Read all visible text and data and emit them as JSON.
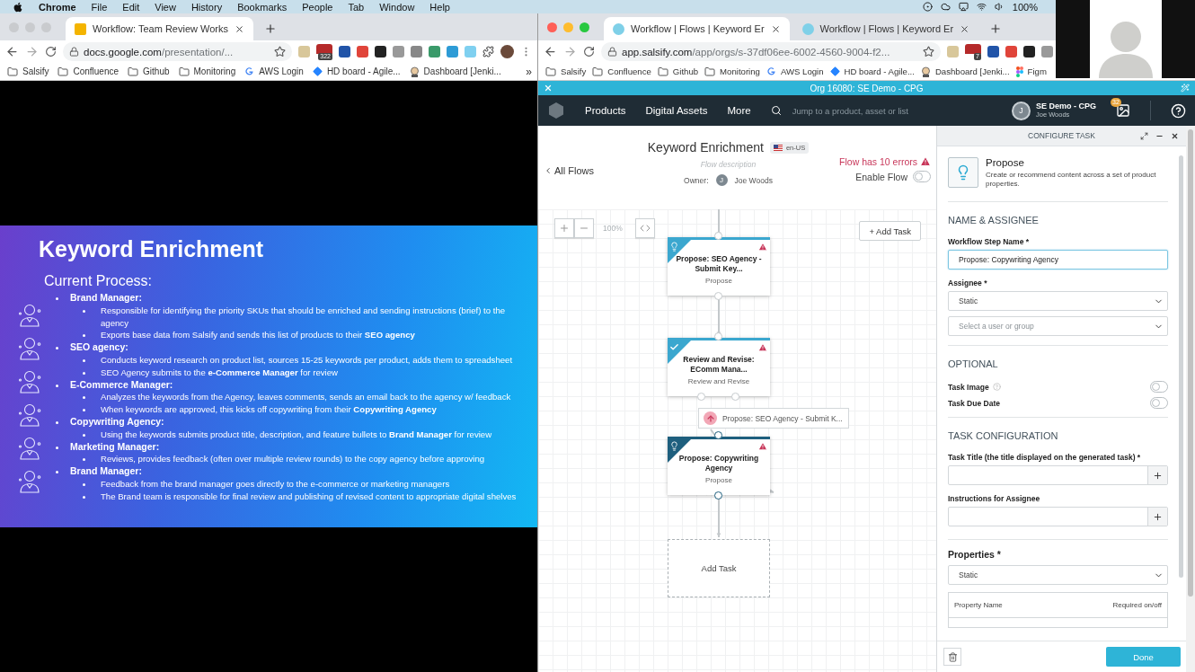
{
  "menu_bar": {
    "app_name": "Chrome",
    "items": [
      "File",
      "Edit",
      "View",
      "History",
      "Bookmarks",
      "People",
      "Tab",
      "Window",
      "Help"
    ],
    "battery": "100%"
  },
  "left_window": {
    "active": false,
    "tabs": [
      {
        "title": "Workflow: Team Review Works",
        "selected": true
      }
    ],
    "url": {
      "host": "docs.google.com",
      "path": "/presentation/..."
    },
    "extension_badge": "322",
    "bookmarks": [
      {
        "label": "Salsify",
        "kind": "folder"
      },
      {
        "label": "Confluence",
        "kind": "folder"
      },
      {
        "label": "Github",
        "kind": "folder"
      },
      {
        "label": "Monitoring",
        "kind": "folder"
      },
      {
        "label": "AWS Login",
        "kind": "g"
      },
      {
        "label": "HD board - Agile...",
        "kind": "diamond"
      },
      {
        "label": "Dashboard [Jenki...",
        "kind": "face"
      }
    ],
    "bookmarks_overflow": "»",
    "slide": {
      "title": "Keyword Enrichment",
      "subtitle": "Current Process:",
      "items": [
        {
          "text": "Brand Manager:",
          "children": [
            "Responsible for identifying the priority SKUs that should be enriched and sending instructions (brief) to the agency",
            "Exports base data from Salsify and sends this list of products to their **SEO agency**"
          ]
        },
        {
          "text": "SEO agency:",
          "children": [
            "Conducts keyword research on product list, sources 15-25 keywords per product, adds them to spreadsheet",
            "SEO Agency submits to the **e-Commerce Manager** for review"
          ]
        },
        {
          "text": "E-Commerce Manager:",
          "children": [
            "Analyzes the keywords from the Agency, leaves comments, sends an email back to the agency w/ feedback",
            "When keywords are approved, this kicks off copywriting from their **Copywriting Agency**"
          ]
        },
        {
          "text": "Copywriting Agency:",
          "children": [
            "Using the keywords submits product title, description, and feature bullets to **Brand Manager** for review"
          ]
        },
        {
          "text": "Marketing Manager:",
          "children": [
            "Reviews, provides feedback (often over multiple review rounds) to the copy agency before approving"
          ]
        },
        {
          "text": "Brand Manager:",
          "children": [
            "Feedback from the brand manager goes directly to the e-commerce or marketing managers",
            "The Brand team is responsible for final review and publishing of revised content to appropriate digital shelves"
          ]
        }
      ]
    }
  },
  "right_window": {
    "active": true,
    "tabs": [
      {
        "title": "Workflow | Flows | Keyword Er",
        "selected": true
      },
      {
        "title": "Workflow | Flows | Keyword Er",
        "selected": false
      }
    ],
    "url": {
      "host": "app.salsify.com",
      "path": "/app/orgs/s-37df06ee-6002-4560-9004-f2..."
    },
    "extension_badge": "7",
    "bookmarks": [
      {
        "label": "Salsify",
        "kind": "folder"
      },
      {
        "label": "Confluence",
        "kind": "folder"
      },
      {
        "label": "Github",
        "kind": "folder"
      },
      {
        "label": "Monitoring",
        "kind": "folder"
      },
      {
        "label": "AWS Login",
        "kind": "g"
      },
      {
        "label": "HD board - Agile...",
        "kind": "diamond"
      },
      {
        "label": "Dashboard [Jenki...",
        "kind": "face"
      },
      {
        "label": "Figm",
        "kind": "shapes"
      }
    ],
    "app": {
      "org_bar": {
        "title": "Org 16080: SE Demo - CPG"
      },
      "nav": {
        "items": [
          {
            "label": "Products"
          },
          {
            "label": "Digital Assets"
          },
          {
            "label": "More"
          }
        ],
        "search": {
          "placeholder": "Jump to a product, asset or list"
        },
        "account": {
          "initial": "J",
          "org": "SE Demo - CPG",
          "user": "Joe Woods"
        },
        "notification_count": "32"
      },
      "flow": {
        "back_link": "All Flows",
        "title": "Keyword Enrichment",
        "locale": "en-US",
        "description": {
          "placeholder": "Flow description"
        },
        "owner_label": "Owner:",
        "owner": {
          "initial": "J",
          "name": "Joe Woods"
        },
        "errors": "Flow has 10 errors",
        "enable": {
          "label": "Enable Flow",
          "on": false
        },
        "zoom": "100%",
        "add_task": "+ Add Task",
        "nodes": [
          {
            "kind": "propose",
            "title": "Propose: SEO Agency - Submit Key...",
            "subtitle": "Propose",
            "error": true,
            "selected": false
          },
          {
            "kind": "review",
            "title": "Review and Revise: EComm Mana...",
            "subtitle": "Review and Revise",
            "error": true,
            "selected": false
          },
          {
            "kind": "propose",
            "title": "Propose: Copywriting Agency",
            "subtitle": "Propose",
            "error": true,
            "selected": true
          }
        ],
        "link_label": "Propose: SEO Agency - Submit K...",
        "placeholder_node": "Add Task"
      },
      "panel": {
        "title": "CONFIGURE TASK",
        "task_type": {
          "name": "Propose",
          "description": "Create or recommend content across a set of product properties."
        },
        "name_section": "NAME & ASSIGNEE",
        "step_name": {
          "label": "Workflow Step Name *",
          "value": "Propose: Copywriting Agency"
        },
        "assignee": {
          "label": "Assignee *",
          "mode": "Static",
          "user": {
            "placeholder": "Select a user or group"
          }
        },
        "optional_section": "OPTIONAL",
        "toggles": [
          {
            "label": "Task Image",
            "help": true,
            "on": false
          },
          {
            "label": "Task Due Date",
            "help": false,
            "on": false
          }
        ],
        "config_section": "TASK CONFIGURATION",
        "task_title": {
          "label": "Task Title (the title displayed on the generated task) *"
        },
        "instructions": {
          "label": "Instructions for Assignee"
        },
        "properties": {
          "label": "Properties *",
          "mode": "Static",
          "columns": [
            "Property Name",
            "Required on/off"
          ]
        },
        "done": "Done"
      }
    }
  }
}
